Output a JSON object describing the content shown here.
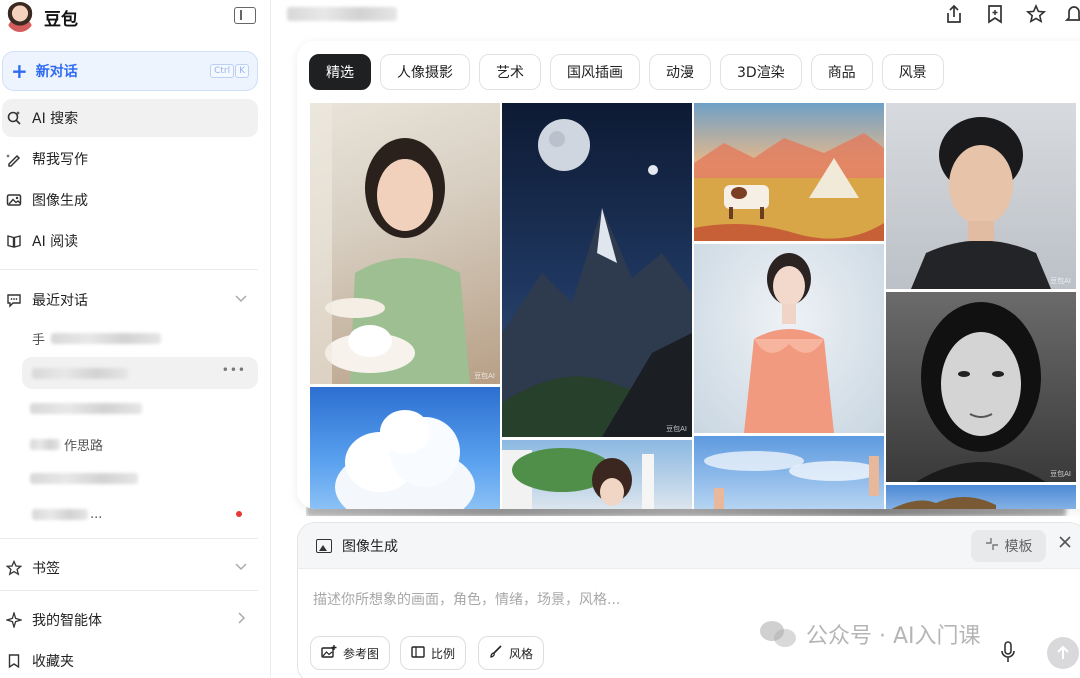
{
  "app": {
    "name": "豆包"
  },
  "sidebar": {
    "new_chat": {
      "label": "新对话",
      "shortcut": [
        "Ctrl",
        "K"
      ]
    },
    "nav": [
      {
        "label": "AI 搜索",
        "icon": "search-spark-icon"
      },
      {
        "label": "帮我写作",
        "icon": "pen-icon"
      },
      {
        "label": "图像生成",
        "icon": "image-icon"
      },
      {
        "label": "AI 阅读",
        "icon": "book-icon"
      }
    ],
    "recent": {
      "title": "最近对话",
      "items": [
        {
          "visible_prefix": "手",
          "visible_suffix": ""
        },
        {
          "visible_prefix": "",
          "visible_suffix": ""
        },
        {
          "visible_prefix": "",
          "visible_suffix": ""
        },
        {
          "visible_prefix": "",
          "visible_suffix": "作思路"
        },
        {
          "visible_prefix": "",
          "visible_suffix": ""
        },
        {
          "visible_prefix": "",
          "visible_suffix": "..."
        }
      ]
    },
    "bookmarks": "书签",
    "my_agents": "我的智能体",
    "favorites": "收藏夹"
  },
  "gallery": {
    "tabs": [
      "精选",
      "人像摄影",
      "艺术",
      "国风插画",
      "动漫",
      "3D渲染",
      "商品",
      "风景"
    ],
    "selected_tab": 0,
    "watermark": "豆包AI"
  },
  "composer": {
    "mode": "图像生成",
    "template_label": "模板",
    "placeholder": "描述你所想象的画面，角色，情绪，场景，风格...",
    "chips": [
      {
        "label": "参考图",
        "icon": "add-image-icon"
      },
      {
        "label": "比例",
        "icon": "ratio-icon"
      },
      {
        "label": "风格",
        "icon": "brush-icon"
      }
    ]
  },
  "overlay_watermark": "公众号 · AI入门课",
  "colors": {
    "accent": "#2f6bf2",
    "selected_tab": "#1f2022",
    "alert_dot": "#e53935"
  }
}
